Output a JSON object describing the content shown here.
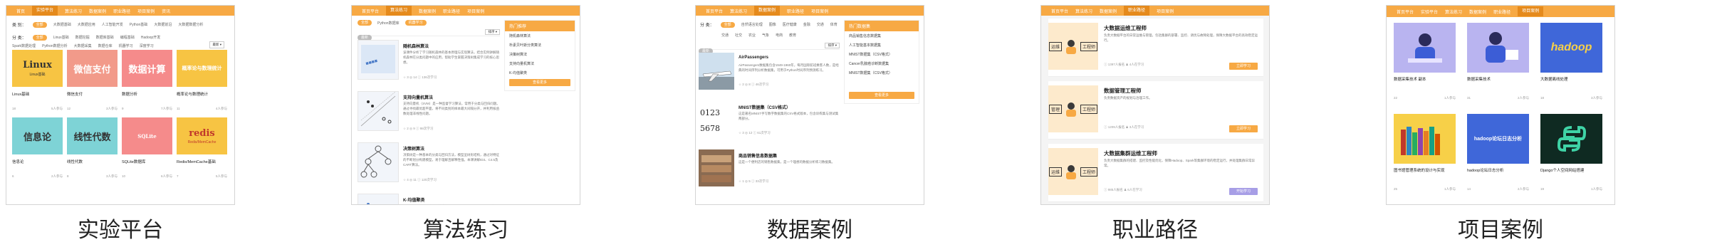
{
  "captions": [
    "实验平台",
    "算法练习",
    "数据案例",
    "职业路径",
    "项目案例"
  ],
  "panel1": {
    "nav": [
      "首页",
      "实验平台",
      "算法练习",
      "数据案例",
      "职业路径",
      "项目案例",
      "资讯"
    ],
    "filter_rows": [
      {
        "label": "类 别：",
        "active": "全部",
        "items": [
          "大数据基础",
          "大数据应用",
          "人工智能开发",
          "Python基础",
          "大数据前沿",
          "大数据数据分析"
        ]
      },
      {
        "label": "分 类：",
        "active": "全部",
        "items": [
          "Linux基础",
          "数据挖掘",
          "数据库基础",
          "编程基础",
          "Hadoop开发",
          "Spark数据处理",
          "Python数据分析",
          "大数据采集",
          "数据仓库",
          "机器学习",
          "深度学习"
        ]
      }
    ],
    "sort": "最新 ▾",
    "cards": [
      {
        "title": "Linux基础",
        "thumb": "Linux",
        "thumb_sub": "Linux基础",
        "bg": "#f7c443",
        "fg": "#333",
        "count": "18",
        "users": "5人参与"
      },
      {
        "title": "微信支付",
        "thumb": "微信支付",
        "thumb_sub": "",
        "bg": "#f29a8a",
        "fg": "#fff",
        "count": "12",
        "users": "3人参与"
      },
      {
        "title": "数据分析",
        "thumb": "数据计算",
        "thumb_sub": "",
        "bg": "#f58b8b",
        "fg": "#fff",
        "count": "9",
        "users": "7人参与"
      },
      {
        "title": "概率论与数理统计",
        "thumb": "概率论与数理统计",
        "thumb_sub": "",
        "bg": "#f7c443",
        "fg": "#fff",
        "count": "11",
        "users": "4人参与"
      },
      {
        "title": "信息论",
        "thumb": "信息论",
        "thumb_sub": "",
        "bg": "#7ed3d6",
        "fg": "#333",
        "count": "6",
        "users": "2人参与"
      },
      {
        "title": "线性代数",
        "thumb": "线性代数",
        "thumb_sub": "",
        "bg": "#7ed3d6",
        "fg": "#333",
        "count": "8",
        "users": "3人参与"
      },
      {
        "title": "SQLite数据库",
        "thumb": "SQLite",
        "thumb_sub": "",
        "bg": "#f58b8b",
        "fg": "#fff",
        "count": "10",
        "users": "6人参与"
      },
      {
        "title": "Redis/MemCache基础",
        "thumb": "redis",
        "thumb_sub": "Redis/MemCache",
        "bg": "#f7c443",
        "fg": "#c0392b",
        "count": "7",
        "users": "5人参与"
      }
    ]
  },
  "panel2": {
    "nav": [
      "首页平台",
      "算法练习",
      "数据案例",
      "职业路径",
      "项目案例"
    ],
    "crumbs": [
      "全部",
      "Python数据库",
      "机器学习"
    ],
    "sort_label": "最新",
    "sort_select": "排序 ▾",
    "items": [
      {
        "title": "随机森林算法",
        "desc": "该课件分析了学习随机森林的基本原理与实现算法，结合实例讲解随机森林在分类问题中的应用，帮助学生掌握决策树集成学习的核心思想。",
        "meta": "☆ 3   ◎ 14   ⓘ 136次学习"
      },
      {
        "title": "支持向量机算法",
        "desc": "支持向量机（SVM）是一种监督学习算法，常用于分类与回归问题。通过寻找最优超平面，将不同类别的样本最大间隔分开，并利用核函数处理非线性问题。",
        "meta": "☆ 2   ◎ 9   ⓘ 98次学习"
      },
      {
        "title": "决策树算法",
        "desc": "决策树是一种基本的分类与回归方法，模型呈树形结构，通过对特征的不断划分构建模型，易于理解且解释性强。本课讲解ID3、C4.5及CART算法。",
        "meta": "☆ 4   ◎ 11   ⓘ 120次学习"
      },
      {
        "title": "K-均值聚类",
        "desc": "K-means是最常用的聚类算法之一，通过迭代将样本划分为K个簇，使得簇内样本相似度高、簇间差异大。",
        "meta": "☆ 1   ◎ 6   ⓘ 75次学习"
      }
    ],
    "side_title": "热门推荐",
    "side_items": [
      "随机森林算法",
      "朴素贝叶斯分类算法",
      "决策树算法",
      "支持向量机算法",
      "K-均值聚类"
    ],
    "side_button": "查看更多"
  },
  "panel3": {
    "nav": [
      "首页平台",
      "算法练习",
      "数据案例",
      "职业路径",
      "项目案例"
    ],
    "filter_label": "分 类：",
    "filter_active": "全部",
    "filters1": [
      "自然语言处理",
      "图像",
      "医疗健康",
      "金融",
      "交通",
      "体育",
      "环境"
    ],
    "filters2": [
      "交通",
      "社交",
      "农业",
      "气象",
      "电商",
      "教育"
    ],
    "sort_label": "最新",
    "sort_select": "排序 ▾",
    "items": [
      {
        "title": "AirPassengers",
        "desc": "AirPassengers数据集包含1949-1960年，每月国际航班乘客人数，是经典的时间序列分析数据集，可用于Python时间序列预测练习。",
        "meta": "☆ 2   ◎ 8   ⓘ 46次学习",
        "pic": "plane"
      },
      {
        "title": "MNIST数据集（CSV格式）",
        "desc": "这是著名MNIST手写数字数据集的CSV格式版本，包含训练集与测试集两部分。",
        "meta": "☆ 3   ◎ 12   ⓘ 61次学习",
        "pic": "digits"
      },
      {
        "title": "商品销售信息数据集",
        "desc": "这是一个便利店的销售数据集，是一个理想的数据分析练习数据集。",
        "meta": "☆ 1   ◎ 5   ⓘ 33次学习",
        "pic": "shop"
      }
    ],
    "side_title": "热门数据集",
    "side_items": [
      "商品销售信息数据集",
      "人工智能基本数据集",
      "MNIST数据集（CSV格式）",
      "Cancer乳腺癌诊断数据集",
      "MNIST数据集（CSV格式）"
    ],
    "side_button": "查看更多"
  },
  "panel4": {
    "nav": [
      "首页平台",
      "算法练习",
      "数据案例",
      "职业路径",
      "项目案例"
    ],
    "paths": [
      {
        "title": "大数据运维工程师",
        "pic_left": "运维",
        "pic_right": "工程师",
        "desc": "负责大数据平台的日常运维与管理，包括集群的部署、监控、调优与故障处理，保障大数据平台的高效稳定运行。",
        "meta": "ⓘ 1397人报名    ♟ 4人在学习",
        "button": "立即学习",
        "button_style": "orange"
      },
      {
        "title": "数据管理工程师",
        "pic_left": "管理",
        "pic_right": "工程师",
        "desc": "负责数据资产的规划与治理工作。",
        "meta": "ⓘ 1209人报名    ♟ 3人在学习",
        "button": "立即学习",
        "button_style": "orange"
      },
      {
        "title": "大数据集群运维工程师",
        "pic_left": "运维",
        "pic_right": "工程师",
        "desc": "负责大数据集群的搭建、监控及性能优化，保障Hadoop、Spark等集群环境的稳定运行，并处理集群日常异常。",
        "meta": "ⓘ 985人报名    ♟ 6人在学习",
        "button": "开始学习",
        "button_style": "purple"
      }
    ]
  },
  "panel5": {
    "nav": [
      "首页平台",
      "实验平台",
      "算法练习",
      "数据案例",
      "职业路径",
      "项目案例"
    ],
    "nav_active": "项目案例",
    "cards": [
      {
        "title": "数据采集技术 副本",
        "count": "22",
        "users": "1人参与",
        "thumb": "person1"
      },
      {
        "title": "数据采集技术",
        "count": "31",
        "users": "2人参与",
        "thumb": "person2"
      },
      {
        "title": "大数据离线处理",
        "count": "18",
        "users": "3人参与",
        "thumb": "hadoop"
      },
      {
        "title": "图书馆管理系统的设计与实现",
        "count": "25",
        "users": "1人参与",
        "thumb": "books"
      },
      {
        "title": "hadoop论坛日志分析",
        "count": "14",
        "users": "2人参与",
        "thumb": "hadoop2"
      },
      {
        "title": "Django个人空间网站搭建",
        "count": "19",
        "users": "1人参与",
        "thumb": "python"
      }
    ],
    "hadoop_text": "hadoop",
    "hadoop2_text": "hadoop论坛日志分析"
  }
}
